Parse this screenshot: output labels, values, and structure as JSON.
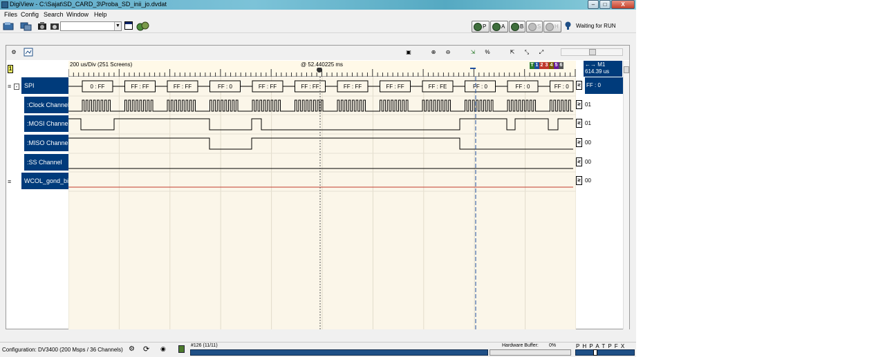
{
  "window": {
    "title": "DigiView - C:\\Sajat\\SD_CARD_3\\Proba_SD_inii_jo.dvdat",
    "min_glyph": "–",
    "max_glyph": "□",
    "close_glyph": "X"
  },
  "menu": [
    "Files",
    "Config",
    "Search",
    "Window",
    "Help"
  ],
  "toolbar": {
    "run_buttons": [
      {
        "label": "P",
        "active": true
      },
      {
        "label": "A",
        "active": true
      },
      {
        "label": "B",
        "active": true
      },
      {
        "label": "S",
        "active": false
      },
      {
        "label": "H",
        "active": false
      }
    ],
    "status": "Waiting for RUN",
    "icons": [
      "open-file-icon",
      "save-file-icon",
      "capture-icon",
      "capture-setup-icon",
      "window-icon",
      "hardware-config-icon",
      "lightbulb-icon"
    ]
  },
  "timebar": {
    "div": "200 us/Div  (251 Screens)",
    "center": "@ 52.440225 ms",
    "marker_t_labels": [
      "T",
      "1",
      "2",
      "3",
      "4",
      "5",
      "6"
    ],
    "marker_colors": [
      "#2f7d2f",
      "#1f4f9e",
      "#c0392b",
      "#c0392b",
      "#7a5c00",
      "#6a1b9a",
      "#555555"
    ],
    "m1_label": "←→ M1",
    "m1_value": "614.39 us",
    "screen_marker": "1",
    "cursor_marker": "1"
  },
  "channels": [
    {
      "name": "SPI",
      "value": "FF : 0",
      "kind": "bus",
      "selected": true,
      "collapse_glyph": "-"
    },
    {
      "name": ":Clock Channel",
      "value": "01",
      "kind": "clock"
    },
    {
      "name": ":MOSI Channel",
      "value": "01",
      "kind": "mosi"
    },
    {
      "name": ":MISO Channel",
      "value": "00",
      "kind": "miso"
    },
    {
      "name": ":SS Channel",
      "value": "00",
      "kind": "ss"
    },
    {
      "name": "WCOL_gond_bit",
      "value": "00",
      "kind": "flag"
    }
  ],
  "spi_frames": [
    "0 : FF",
    "FF : FF",
    "FF : FF",
    "FF : 0",
    "FF : FF",
    "FF : FF",
    "FF : FF",
    "FF : FF",
    "FF : FE",
    "FF : 0",
    "FF : 0",
    "FF : 0"
  ],
  "status": {
    "config_label": "Configuration:",
    "config_value": "DV3400 (200 Msps / 36 Channels)",
    "count": "#126 (11/11)",
    "hw_label": "Hardware Buffer:",
    "hw_value": "0%",
    "letters": "P H   P A T   P F X"
  },
  "colors": {
    "label_bg": "#003b7b",
    "wave": "#000000",
    "flag_line": "#c0392b",
    "plot_bg": "#fbf6e9"
  }
}
